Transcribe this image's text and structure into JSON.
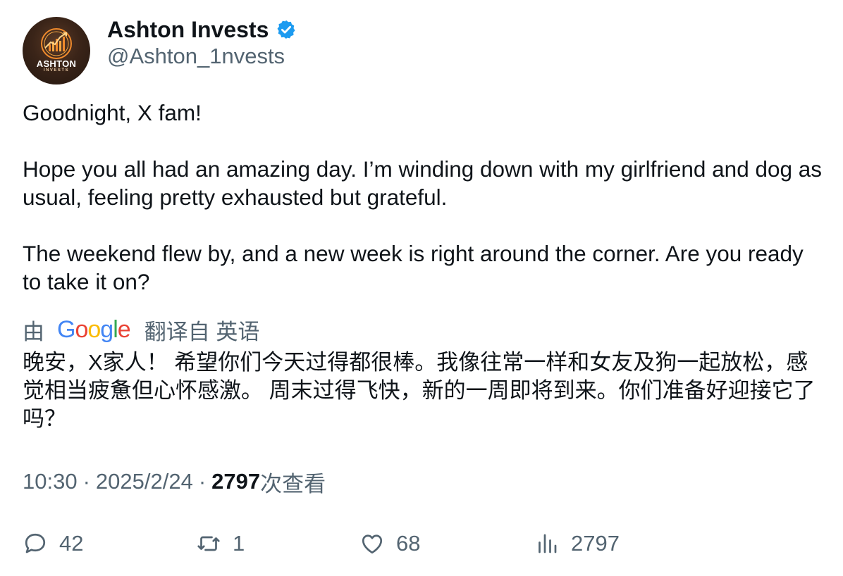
{
  "author": {
    "display_name": "Ashton Invests",
    "handle": "@Ashton_1nvests",
    "avatar_text": "ASHTON",
    "avatar_subtext": "INVESTS",
    "verified_color": "#1d9bf0"
  },
  "tweet": {
    "paragraphs": [
      "Goodnight, X fam!",
      "Hope you all had an amazing day. I’m winding down with my girlfriend and dog as usual, feeling pretty exhausted but grateful.",
      "The weekend flew by, and a new week is right around the corner. Are you ready to take it on?"
    ]
  },
  "translation": {
    "prefix": "由",
    "provider_letters": [
      "G",
      "o",
      "o",
      "g",
      "l",
      "e"
    ],
    "suffix": "翻译自 英语",
    "text": "晚安，X家人！ 希望你们今天过得都很棒。我像往常一样和女友及狗一起放松，感觉相当疲惫但心怀感激。 周末过得飞快，新的一周即将到来。你们准备好迎接它了吗？"
  },
  "meta": {
    "time": "10:30",
    "separator": "·",
    "date": "2025/2/24",
    "views_count": "2797",
    "views_label": "次查看"
  },
  "actions": {
    "replies": "42",
    "retweets": "1",
    "likes": "68",
    "views": "2797"
  },
  "colors": {
    "text_primary": "#0f1419",
    "text_secondary": "#536471",
    "accent": "#1d9bf0"
  }
}
